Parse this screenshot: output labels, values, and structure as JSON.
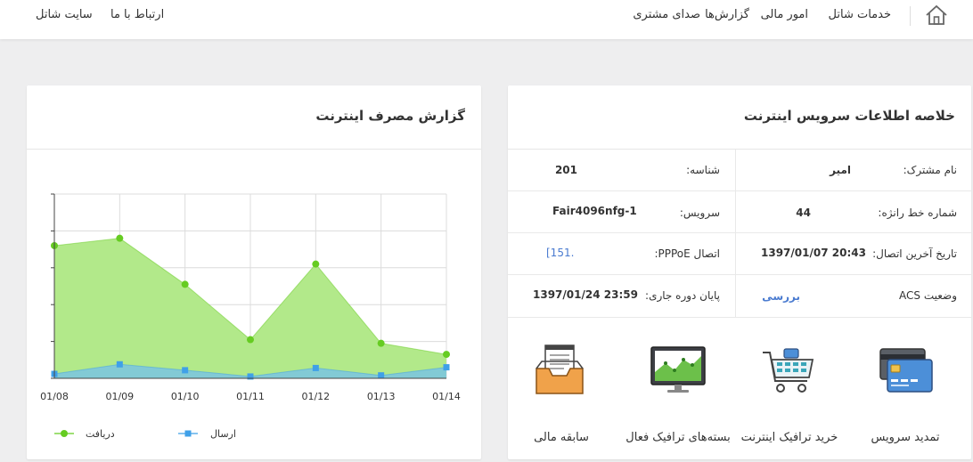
{
  "nav": {
    "home_icon": "home-icon",
    "right_items": [
      "خدمات شاتل",
      "امور مالی",
      "گزارش‌ها",
      "صدای مشتری"
    ],
    "left_items": [
      "ارتباط با ما",
      "سایت شاتل"
    ]
  },
  "usage_card": {
    "title": "گزارش مصرف اینترنت"
  },
  "summary_card": {
    "title": "خلاصه اطلاعات سرویس اینترنت",
    "rows": [
      {
        "label1": "نام مشترک:",
        "value1": "امیر",
        "label2": "شناسه:",
        "value2": "201"
      },
      {
        "label1": "شماره خط رانژه:",
        "value1": "44",
        "label2": "سرویس:",
        "value2": "Fair4096nfg-1"
      },
      {
        "label1": "تاریخ آخرین اتصال:",
        "value1": "1397/01/07 20:43",
        "label2": "اتصال PPPoE:",
        "value2": "[151."
      },
      {
        "label1": "وضعیت ACS",
        "value1": "بررسی",
        "label2": "پایان دوره جاری:",
        "value2": "1397/01/24 23:59"
      }
    ],
    "tiles": [
      {
        "label": "تمدید سرویس",
        "icon": "credit-card-icon"
      },
      {
        "label": "خرید ترافیک اینترنت",
        "icon": "shopping-cart-icon"
      },
      {
        "label": "بسته‌های ترافیک فعال",
        "icon": "monitor-chart-icon"
      },
      {
        "label": "سابقه مالی",
        "icon": "inbox-tray-icon"
      }
    ]
  },
  "chart_data": {
    "type": "area",
    "categories": [
      "01/08",
      "01/09",
      "01/10",
      "01/11",
      "01/12",
      "01/13",
      "01/14"
    ],
    "series": [
      {
        "name": "دریافت",
        "values": [
          3.6,
          3.8,
          2.55,
          1.05,
          3.1,
          0.95,
          0.65
        ],
        "color": "#66cc22",
        "fill": "#b2e98a"
      },
      {
        "name": "ارسال",
        "values": [
          0.12,
          0.38,
          0.22,
          0.05,
          0.28,
          0.08,
          0.3
        ],
        "color": "#3fa0e8",
        "fill": "#7cc6dd"
      }
    ],
    "ylim": [
      0,
      5
    ],
    "grid": true,
    "legend": "bottom"
  }
}
